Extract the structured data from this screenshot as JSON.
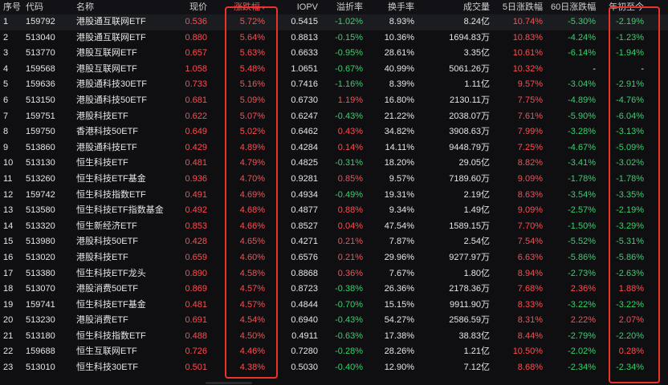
{
  "headers": {
    "idx": "序号",
    "code": "代码",
    "name": "名称",
    "price": "现价",
    "chg": "涨跌幅",
    "iopv": "IOPV",
    "prem": "溢折率",
    "turn": "换手率",
    "vol": "成交量",
    "d5": "5日涨跌幅",
    "d60": "60日涨跌幅",
    "ytd": "年初至今"
  },
  "sort_indicator": "▾",
  "colors": {
    "up": "#ff4d4f",
    "down": "#33d46a",
    "highlight_box": "#e8342b"
  },
  "rows": [
    {
      "idx": "1",
      "code": "159792",
      "name": "港股通互联网ETF",
      "price": "0.536",
      "chg": "5.72%",
      "iopv": "0.5415",
      "prem": "-1.02%",
      "turn": "8.93%",
      "vol": "8.24亿",
      "d5": "10.74%",
      "d60": "-5.30%",
      "ytd": "-2.19%"
    },
    {
      "idx": "2",
      "code": "513040",
      "name": "港股通互联网ETF",
      "price": "0.880",
      "chg": "5.64%",
      "iopv": "0.8813",
      "prem": "-0.15%",
      "turn": "10.36%",
      "vol": "1694.83万",
      "d5": "10.83%",
      "d60": "-4.24%",
      "ytd": "-1.23%"
    },
    {
      "idx": "3",
      "code": "513770",
      "name": "港股互联网ETF",
      "price": "0.657",
      "chg": "5.63%",
      "iopv": "0.6633",
      "prem": "-0.95%",
      "turn": "28.61%",
      "vol": "3.35亿",
      "d5": "10.61%",
      "d60": "-6.14%",
      "ytd": "-1.94%"
    },
    {
      "idx": "4",
      "code": "159568",
      "name": "港股互联网ETF",
      "price": "1.058",
      "chg": "5.48%",
      "iopv": "1.0651",
      "prem": "-0.67%",
      "turn": "40.99%",
      "vol": "5061.26万",
      "d5": "10.32%",
      "d60": "-",
      "ytd": "-"
    },
    {
      "idx": "5",
      "code": "159636",
      "name": "港股通科技30ETF",
      "price": "0.733",
      "chg": "5.16%",
      "iopv": "0.7416",
      "prem": "-1.16%",
      "turn": "8.39%",
      "vol": "1.11亿",
      "d5": "9.57%",
      "d60": "-3.04%",
      "ytd": "-2.91%"
    },
    {
      "idx": "6",
      "code": "513150",
      "name": "港股通科技50ETF",
      "price": "0.681",
      "chg": "5.09%",
      "iopv": "0.6730",
      "prem": "1.19%",
      "turn": "16.80%",
      "vol": "2130.11万",
      "d5": "7.75%",
      "d60": "-4.89%",
      "ytd": "-4.76%"
    },
    {
      "idx": "7",
      "code": "159751",
      "name": "港股科技ETF",
      "price": "0.622",
      "chg": "5.07%",
      "iopv": "0.6247",
      "prem": "-0.43%",
      "turn": "21.22%",
      "vol": "2038.07万",
      "d5": "7.61%",
      "d60": "-5.90%",
      "ytd": "-6.04%"
    },
    {
      "idx": "8",
      "code": "159750",
      "name": "香港科技50ETF",
      "price": "0.649",
      "chg": "5.02%",
      "iopv": "0.6462",
      "prem": "0.43%",
      "turn": "34.82%",
      "vol": "3908.63万",
      "d5": "7.99%",
      "d60": "-3.28%",
      "ytd": "-3.13%"
    },
    {
      "idx": "9",
      "code": "513860",
      "name": "港股通科技ETF",
      "price": "0.429",
      "chg": "4.89%",
      "iopv": "0.4284",
      "prem": "0.14%",
      "turn": "14.11%",
      "vol": "9448.79万",
      "d5": "7.25%",
      "d60": "-4.67%",
      "ytd": "-5.09%"
    },
    {
      "idx": "10",
      "code": "513130",
      "name": "恒生科技ETF",
      "price": "0.481",
      "chg": "4.79%",
      "iopv": "0.4825",
      "prem": "-0.31%",
      "turn": "18.20%",
      "vol": "29.05亿",
      "d5": "8.82%",
      "d60": "-3.41%",
      "ytd": "-3.02%"
    },
    {
      "idx": "11",
      "code": "513260",
      "name": "恒生科技ETF基金",
      "price": "0.936",
      "chg": "4.70%",
      "iopv": "0.9281",
      "prem": "0.85%",
      "turn": "9.57%",
      "vol": "7189.60万",
      "d5": "9.09%",
      "d60": "-1.78%",
      "ytd": "-1.78%"
    },
    {
      "idx": "12",
      "code": "159742",
      "name": "恒生科技指数ETF",
      "price": "0.491",
      "chg": "4.69%",
      "iopv": "0.4934",
      "prem": "-0.49%",
      "turn": "19.31%",
      "vol": "2.19亿",
      "d5": "8.63%",
      "d60": "-3.54%",
      "ytd": "-3.35%"
    },
    {
      "idx": "13",
      "code": "513580",
      "name": "恒生科技ETF指数基金",
      "price": "0.492",
      "chg": "4.68%",
      "iopv": "0.4877",
      "prem": "0.88%",
      "turn": "9.34%",
      "vol": "1.49亿",
      "d5": "9.09%",
      "d60": "-2.57%",
      "ytd": "-2.19%"
    },
    {
      "idx": "14",
      "code": "513320",
      "name": "恒生新经济ETF",
      "price": "0.853",
      "chg": "4.66%",
      "iopv": "0.8527",
      "prem": "0.04%",
      "turn": "47.54%",
      "vol": "1589.15万",
      "d5": "7.70%",
      "d60": "-1.50%",
      "ytd": "-3.29%"
    },
    {
      "idx": "15",
      "code": "513980",
      "name": "港股科技50ETF",
      "price": "0.428",
      "chg": "4.65%",
      "iopv": "0.4271",
      "prem": "0.21%",
      "turn": "7.87%",
      "vol": "2.54亿",
      "d5": "7.54%",
      "d60": "-5.52%",
      "ytd": "-5.31%"
    },
    {
      "idx": "16",
      "code": "513020",
      "name": "港股科技ETF",
      "price": "0.659",
      "chg": "4.60%",
      "iopv": "0.6576",
      "prem": "0.21%",
      "turn": "29.96%",
      "vol": "9277.97万",
      "d5": "6.63%",
      "d60": "-5.86%",
      "ytd": "-5.86%"
    },
    {
      "idx": "17",
      "code": "513380",
      "name": "恒生科技ETF龙头",
      "price": "0.890",
      "chg": "4.58%",
      "iopv": "0.8868",
      "prem": "0.36%",
      "turn": "7.67%",
      "vol": "1.80亿",
      "d5": "8.94%",
      "d60": "-2.73%",
      "ytd": "-2.63%"
    },
    {
      "idx": "18",
      "code": "513070",
      "name": "港股消费50ETF",
      "price": "0.869",
      "chg": "4.57%",
      "iopv": "0.8723",
      "prem": "-0.38%",
      "turn": "26.36%",
      "vol": "2178.36万",
      "d5": "7.68%",
      "d60": "2.36%",
      "ytd": "1.88%"
    },
    {
      "idx": "19",
      "code": "159741",
      "name": "恒生科技ETF基金",
      "price": "0.481",
      "chg": "4.57%",
      "iopv": "0.4844",
      "prem": "-0.70%",
      "turn": "15.15%",
      "vol": "9911.90万",
      "d5": "8.33%",
      "d60": "-3.22%",
      "ytd": "-3.22%"
    },
    {
      "idx": "20",
      "code": "513230",
      "name": "港股消费ETF",
      "price": "0.691",
      "chg": "4.54%",
      "iopv": "0.6940",
      "prem": "-0.43%",
      "turn": "54.27%",
      "vol": "2586.59万",
      "d5": "8.31%",
      "d60": "2.22%",
      "ytd": "2.07%"
    },
    {
      "idx": "21",
      "code": "513180",
      "name": "恒生科技指数ETF",
      "price": "0.488",
      "chg": "4.50%",
      "iopv": "0.4911",
      "prem": "-0.63%",
      "turn": "17.38%",
      "vol": "38.83亿",
      "d5": "8.44%",
      "d60": "-2.79%",
      "ytd": "-2.20%"
    },
    {
      "idx": "22",
      "code": "159688",
      "name": "恒生互联网ETF",
      "price": "0.726",
      "chg": "4.46%",
      "iopv": "0.7280",
      "prem": "-0.28%",
      "turn": "28.26%",
      "vol": "1.21亿",
      "d5": "10.50%",
      "d60": "-2.02%",
      "ytd": "0.28%"
    },
    {
      "idx": "23",
      "code": "513010",
      "name": "恒生科技30ETF",
      "price": "0.501",
      "chg": "4.38%",
      "iopv": "0.5030",
      "prem": "-0.40%",
      "turn": "12.90%",
      "vol": "7.12亿",
      "d5": "8.68%",
      "d60": "-2.34%",
      "ytd": "-2.34%"
    }
  ]
}
